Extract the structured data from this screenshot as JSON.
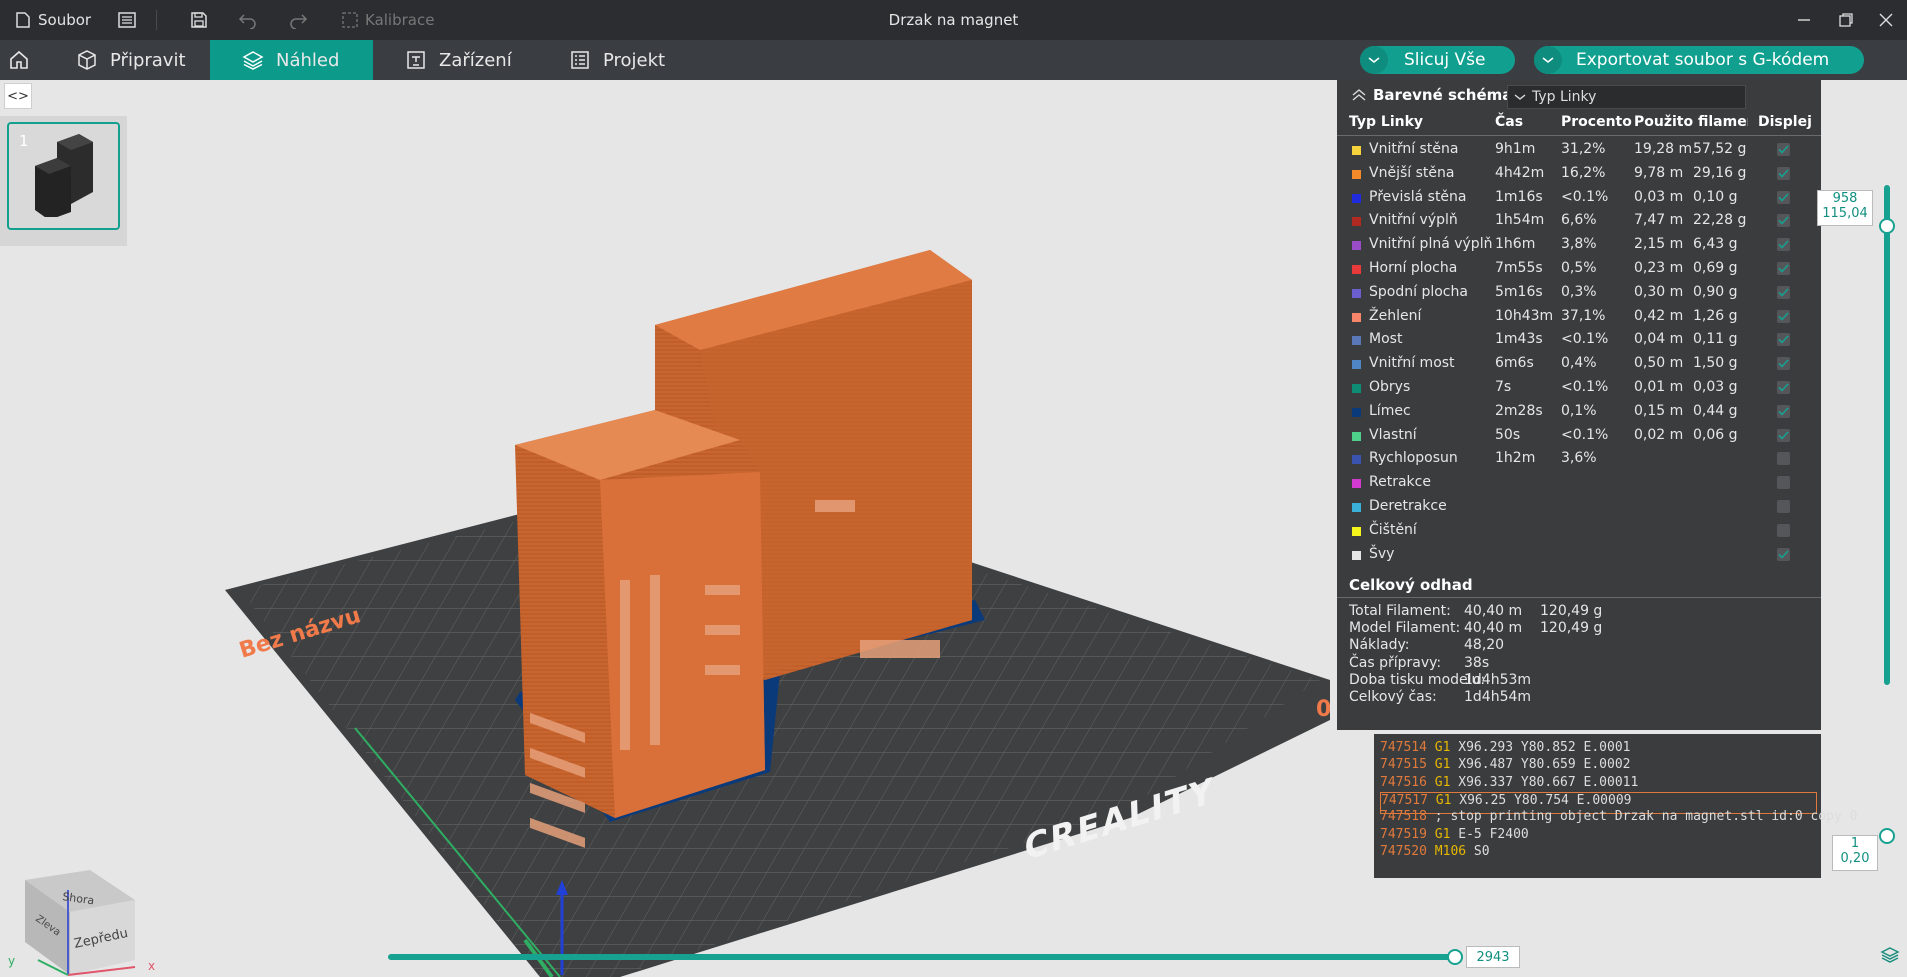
{
  "titlebar": {
    "file_label": "Soubor",
    "calibration_label": "Kalibrace",
    "window_title": "Drzak na magnet"
  },
  "tabs": [
    {
      "label": "Připravit"
    },
    {
      "label": "Náhled"
    },
    {
      "label": "Zařízení"
    },
    {
      "label": "Projekt"
    }
  ],
  "actions": {
    "slice_all": "Slicuj Vše",
    "export_gcode": "Exportovat soubor s G-kódem"
  },
  "thumbnail": {
    "index": "1"
  },
  "scene": {
    "plate_name": "Bez názvu",
    "brand": "CREALITY",
    "plate_number_fragment": "0",
    "cube_top": "Shora",
    "cube_left": "Zleva",
    "cube_front": "Zepředu",
    "axis_x": "x",
    "axis_y": "y"
  },
  "legend": {
    "title": "Barevné schéma",
    "scheme_value": "Typ Linky",
    "columns": [
      "Typ Linky",
      "Čas",
      "Procento",
      "Použito filamentu",
      "Displej"
    ],
    "rows": [
      {
        "name": "Vnitřní stěna",
        "color": "#f5d33c",
        "time": "9h1m",
        "pct": "31,2%",
        "len": "19,28 m",
        "weight": "57,52 g",
        "checked": true
      },
      {
        "name": "Vnější stěna",
        "color": "#f58a2a",
        "time": "4h42m",
        "pct": "16,2%",
        "len": "9,78 m",
        "weight": "29,16 g",
        "checked": true
      },
      {
        "name": "Převislá stěna",
        "color": "#1f2bdc",
        "time": "1m16s",
        "pct": "<0.1%",
        "len": "0,03 m",
        "weight": "0,10 g",
        "checked": true
      },
      {
        "name": "Vnitřní výplň",
        "color": "#b02a22",
        "time": "1h54m",
        "pct": "6,6%",
        "len": "7,47 m",
        "weight": "22,28 g",
        "checked": true
      },
      {
        "name": "Vnitřní plná výplň",
        "color": "#9a4dc8",
        "time": "1h6m",
        "pct": "3,8%",
        "len": "2,15 m",
        "weight": "6,43 g",
        "checked": true
      },
      {
        "name": "Horní plocha",
        "color": "#e83a3a",
        "time": "7m55s",
        "pct": "0,5%",
        "len": "0,23 m",
        "weight": "0,69 g",
        "checked": true
      },
      {
        "name": "Spodní plocha",
        "color": "#6b5fd0",
        "time": "5m16s",
        "pct": "0,3%",
        "len": "0,30 m",
        "weight": "0,90 g",
        "checked": true
      },
      {
        "name": "Žehlení",
        "color": "#f7856a",
        "time": "10h43m",
        "pct": "37,1%",
        "len": "0,42 m",
        "weight": "1,26 g",
        "checked": true
      },
      {
        "name": "Most",
        "color": "#5a78b8",
        "time": "1m43s",
        "pct": "<0.1%",
        "len": "0,04 m",
        "weight": "0,11 g",
        "checked": true
      },
      {
        "name": "Vnitřní most",
        "color": "#4f86c6",
        "time": "6m6s",
        "pct": "0,4%",
        "len": "0,50 m",
        "weight": "1,50 g",
        "checked": true
      },
      {
        "name": "Obrys",
        "color": "#0f8c74",
        "time": "7s",
        "pct": "<0.1%",
        "len": "0,01 m",
        "weight": "0,03 g",
        "checked": true
      },
      {
        "name": "Límec",
        "color": "#0b3a7a",
        "time": "2m28s",
        "pct": "0,1%",
        "len": "0,15 m",
        "weight": "0,44 g",
        "checked": true
      },
      {
        "name": "Vlastní",
        "color": "#4fd08a",
        "time": "50s",
        "pct": "<0.1%",
        "len": "0,02 m",
        "weight": "0,06 g",
        "checked": true
      },
      {
        "name": "Rychloposun",
        "color": "#3a52b0",
        "time": "1h2m",
        "pct": "3,6%",
        "len": "",
        "weight": "",
        "checked": false
      },
      {
        "name": "Retrakce",
        "color": "#d23ad2",
        "time": "",
        "pct": "",
        "len": "",
        "weight": "",
        "checked": false
      },
      {
        "name": "Deretrakce",
        "color": "#3ab0d8",
        "time": "",
        "pct": "",
        "len": "",
        "weight": "",
        "checked": false
      },
      {
        "name": "Čištění",
        "color": "#f5f51c",
        "time": "",
        "pct": "",
        "len": "",
        "weight": "",
        "checked": false
      },
      {
        "name": "Švy",
        "color": "#e6e6e6",
        "time": "",
        "pct": "",
        "len": "",
        "weight": "",
        "checked": true
      }
    ],
    "summary": {
      "title": "Celkový odhad",
      "rows": [
        {
          "label": "Total Filament:",
          "v1": "40,40 m",
          "v2": "120,49 g"
        },
        {
          "label": "Model Filament:",
          "v1": "40,40 m",
          "v2": "120,49 g"
        },
        {
          "label": "Náklady:",
          "v1": "48,20",
          "v2": ""
        },
        {
          "label": "Čas přípravy:",
          "v1": "38s",
          "v2": ""
        },
        {
          "label": "Doba tisku modelu:",
          "v1": "1d4h53m",
          "v2": ""
        },
        {
          "label": "Celkový čas:",
          "v1": "1d4h54m",
          "v2": ""
        }
      ]
    }
  },
  "gcode": [
    {
      "ln": "747514",
      "cmd": "G1",
      "rest": " X96.293 Y80.852 E.0001",
      "hl": false
    },
    {
      "ln": "747515",
      "cmd": "G1",
      "rest": " X96.487 Y80.659 E.0002",
      "hl": false
    },
    {
      "ln": "747516",
      "cmd": "G1",
      "rest": " X96.337 Y80.667 E.00011",
      "hl": false
    },
    {
      "ln": "747517",
      "cmd": "G1",
      "rest": " X96.25 Y80.754 E.00009",
      "hl": true
    },
    {
      "ln": "747518",
      "cmd": "",
      "rest": "; stop printing object Drzak na magnet.stl id:0 copy 0",
      "hl": false
    },
    {
      "ln": "747519",
      "cmd": "G1",
      "rest": " E-5 F2400",
      "hl": false
    },
    {
      "ln": "747520",
      "cmd": "M106",
      "rest": " S0",
      "hl": false
    }
  ],
  "layer_slider": {
    "top_layer": "958",
    "top_height": "115,04",
    "bottom_layer": "1",
    "bottom_height": "0,20"
  },
  "move_slider": {
    "value": "2943"
  }
}
